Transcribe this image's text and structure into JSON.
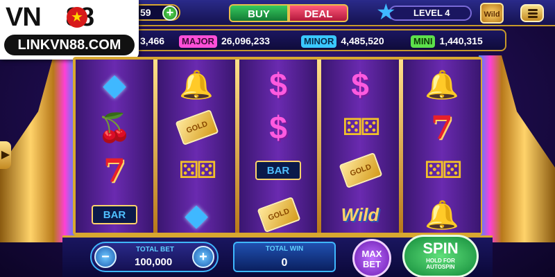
{
  "header": {
    "coins": "59",
    "plus_label": "+",
    "buy_label": "BUY",
    "deal_label": "DEAL",
    "level_label": "LEVEL 4",
    "wild_badge": "Wild",
    "menu_icon": "hamburger-menu-icon"
  },
  "logo": {
    "top_left": "VN",
    "top_right": "88",
    "bottom": "LINKVN88.COM"
  },
  "jackpots": {
    "grand_value": "3,466",
    "major_label": "MAJOR",
    "major_value": "26,096,233",
    "minor_label": "MINOR",
    "minor_value": "4,485,520",
    "mini_label": "MINI",
    "mini_value": "1,440,315"
  },
  "reels": [
    [
      "diamond",
      "cherry",
      "seven",
      "bar"
    ],
    [
      "bell",
      "gold",
      "dice",
      "diamond"
    ],
    [
      "dollar",
      "dollar",
      "bar",
      "gold"
    ],
    [
      "dollar",
      "dice",
      "gold",
      "wild"
    ],
    [
      "bell",
      "seven",
      "dice",
      "bell"
    ]
  ],
  "symbols": {
    "gold_text": "GOLD",
    "bar_text": "BAR",
    "wild_text": "Wild"
  },
  "bottom": {
    "total_bet_label": "TOTAL BET",
    "total_bet_value": "100,000",
    "minus_label": "−",
    "plus_label": "+",
    "total_win_label": "TOTAL WIN",
    "total_win_value": "0",
    "max_bet_line1": "MAX",
    "max_bet_line2": "BET",
    "spin_label": "SPIN",
    "spin_sub1": "HOLD FOR",
    "spin_sub2": "AUTOSPIN"
  },
  "colors": {
    "frame_gold": "#d8a830",
    "major": "#ff4fd8",
    "minor": "#3ac8ff",
    "mini": "#5de04b",
    "spin": "#1fa84a"
  }
}
